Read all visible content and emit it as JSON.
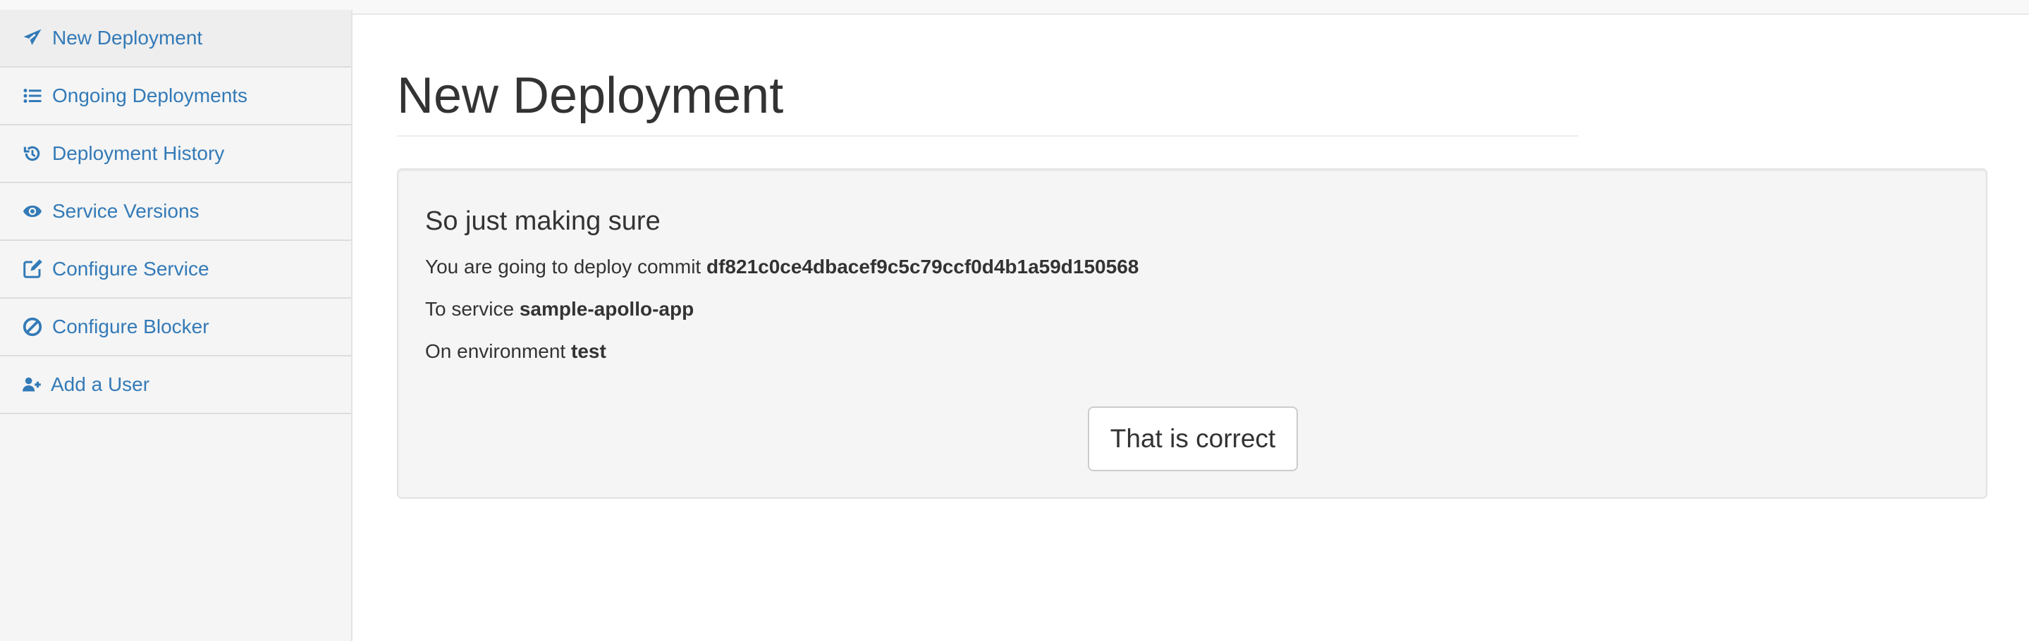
{
  "sidebar": {
    "items": [
      {
        "label": "New Deployment",
        "icon": "paper-plane-icon",
        "active": true
      },
      {
        "label": "Ongoing Deployments",
        "icon": "list-icon",
        "active": false
      },
      {
        "label": "Deployment History",
        "icon": "history-icon",
        "active": false
      },
      {
        "label": "Service Versions",
        "icon": "eye-icon",
        "active": false
      },
      {
        "label": "Configure Service",
        "icon": "edit-icon",
        "active": false
      },
      {
        "label": "Configure Blocker",
        "icon": "ban-icon",
        "active": false
      },
      {
        "label": "Add a User",
        "icon": "user-plus-icon",
        "active": false
      }
    ]
  },
  "main": {
    "title": "New Deployment",
    "confirmation": {
      "heading": "So just making sure",
      "commit_prefix": "You are going to deploy commit",
      "commit": "df821c0ce4dbacef9c5c79ccf0d4b1a59d150568",
      "service_prefix": "To service",
      "service": "sample-apollo-app",
      "environment_prefix": "On environment",
      "environment": "test",
      "button_label": "That is correct"
    }
  },
  "colors": {
    "link": "#337ab7",
    "text": "#333333",
    "sidebar_background": "#f5f5f5",
    "active_item_background": "#eeeeee",
    "well_background": "#f5f5f5",
    "border": "#dddddd"
  }
}
